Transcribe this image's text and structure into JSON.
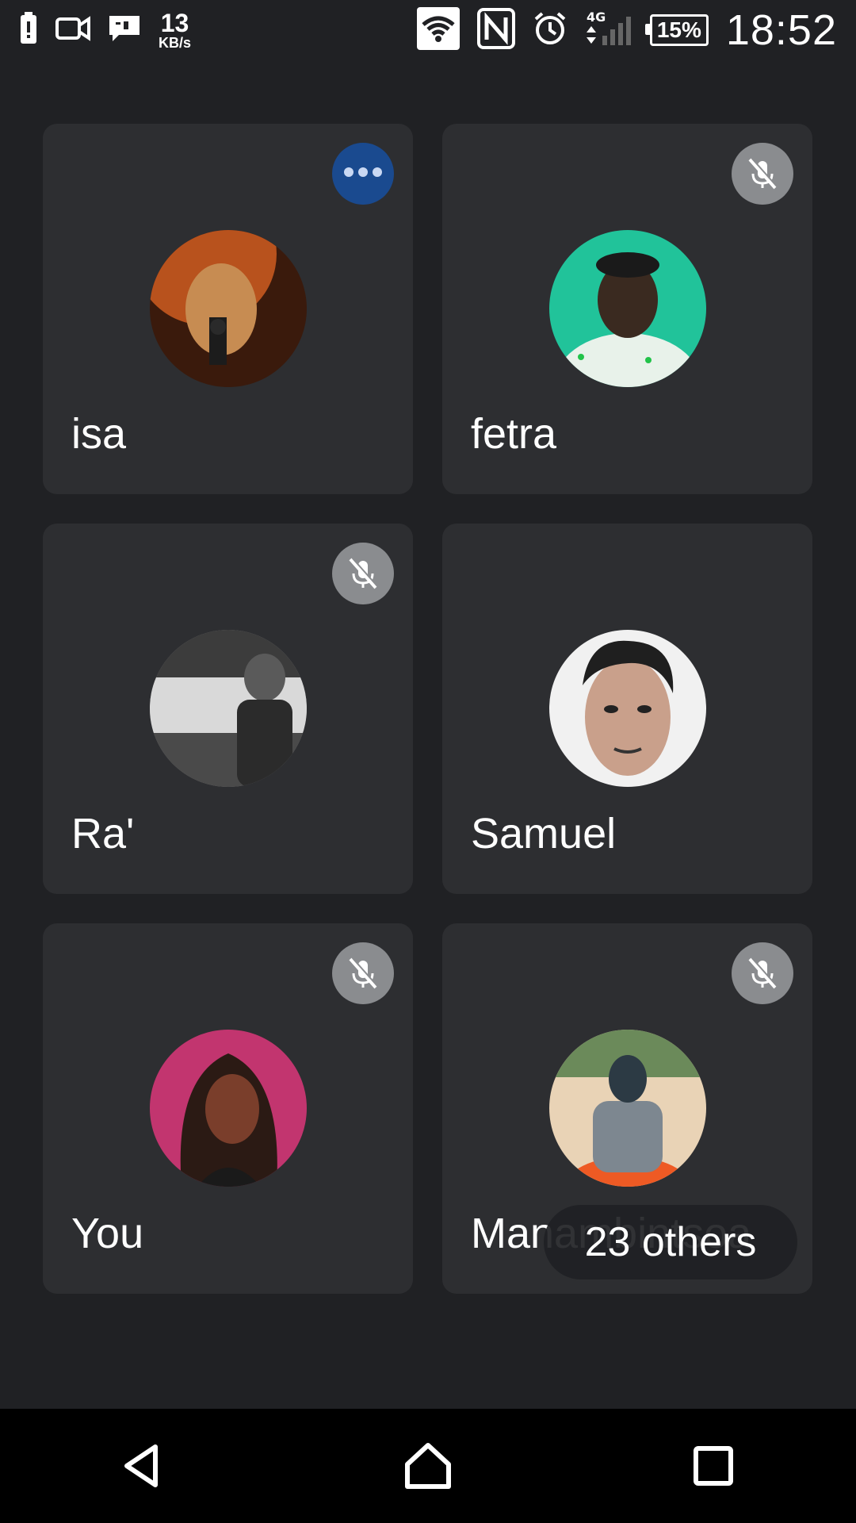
{
  "status_bar": {
    "left_icons": [
      "battery-alert-icon",
      "video-camera-icon",
      "message-icon"
    ],
    "netspeed_value": "13",
    "netspeed_unit": "KB/s",
    "right_icons": [
      "wifi-icon",
      "nfc-icon",
      "alarm-icon",
      "signal-4g-icon"
    ],
    "network_type": "4G",
    "battery": "15%",
    "time": "18:52"
  },
  "participants": [
    {
      "name": "isa",
      "badge": "more-options",
      "avatar_colors": [
        "#b8521d",
        "#3a1a0c",
        "#c78c52"
      ]
    },
    {
      "name": "fetra",
      "badge": "mic-off",
      "avatar_colors": [
        "#21c39a",
        "#e8f2ea",
        "#2b2b2b"
      ]
    },
    {
      "name": "Ra'",
      "badge": "mic-off",
      "avatar_colors": [
        "#d9d9d9",
        "#3c3c3c",
        "#8a8a8a"
      ]
    },
    {
      "name": "Samuel",
      "badge": "none",
      "avatar_colors": [
        "#f1f1f1",
        "#1f1f1f",
        "#c9a08b"
      ]
    },
    {
      "name": "You",
      "badge": "mic-off",
      "avatar_colors": [
        "#c2356f",
        "#2b1a14",
        "#7a3e2b"
      ]
    },
    {
      "name": "Manambintsoa",
      "badge": "mic-off",
      "avatar_colors": [
        "#e9d3b6",
        "#2c3a44",
        "#ee5a24"
      ]
    }
  ],
  "others_chip": "23 others",
  "nav_bar": {
    "back": "back-icon",
    "home": "home-icon",
    "recents": "recents-icon"
  }
}
